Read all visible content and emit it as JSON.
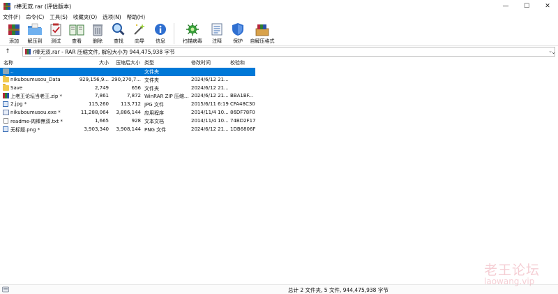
{
  "window": {
    "title": "r棒无双.rar (评估版本)",
    "controls": {
      "minimize": "—",
      "maximize": "☐",
      "close": "✕"
    }
  },
  "menu": {
    "items": [
      "文件(F)",
      "命令(C)",
      "工具(S)",
      "收藏夹(O)",
      "选项(N)",
      "帮助(H)"
    ]
  },
  "toolbar": {
    "buttons": [
      {
        "label": "添加",
        "icon": "add-archive-icon"
      },
      {
        "label": "解压到",
        "icon": "extract-folder-icon"
      },
      {
        "label": "测试",
        "icon": "test-clipboard-icon"
      },
      {
        "label": "查看",
        "icon": "view-book-icon"
      },
      {
        "label": "删除",
        "icon": "trash-icon"
      },
      {
        "label": "查找",
        "icon": "magnifier-icon"
      },
      {
        "label": "向导",
        "icon": "wizard-wand-icon"
      },
      {
        "label": "信息",
        "icon": "info-icon"
      },
      {
        "label": "扫描病毒",
        "icon": "virus-scan-icon"
      },
      {
        "label": "注释",
        "icon": "comment-icon"
      },
      {
        "label": "保护",
        "icon": "shield-icon"
      },
      {
        "label": "自解压格式",
        "icon": "sfx-box-icon"
      }
    ]
  },
  "pathbar": {
    "up_icon": "up-arrow-icon",
    "path_text": "r棒无双.rar - RAR 压缩文件, 解包大小为 944,475,938 字节"
  },
  "columns": {
    "name": "名称",
    "size": "大小",
    "packed": "压缩后大小",
    "type": "类型",
    "modified": "修改时间",
    "crc": "校验和"
  },
  "files": [
    {
      "name": "..",
      "size": "",
      "packed": "",
      "type": "文件夹",
      "modified": "",
      "crc": "",
      "kind": "upfolder",
      "selected": true
    },
    {
      "name": "nikuboumusou_Data",
      "size": "929,156,9...",
      "packed": "290,270,7...",
      "type": "文件夹",
      "modified": "2024/6/12 21...",
      "crc": "",
      "kind": "folder",
      "selected": false
    },
    {
      "name": "Save",
      "size": "2,749",
      "packed": "656",
      "type": "文件夹",
      "modified": "2024/6/12 21...",
      "crc": "",
      "kind": "folder",
      "selected": false
    },
    {
      "name": "上老王论坛当老王.zip *",
      "size": "7,861",
      "packed": "7,872",
      "type": "WinRAR ZIP 压缩...",
      "modified": "2024/6/12 21...",
      "crc": "BBA1BF...",
      "kind": "zip",
      "selected": false
    },
    {
      "name": "2.jpg *",
      "size": "115,260",
      "packed": "113,712",
      "type": "JPG 文件",
      "modified": "2015/6/11 6:19",
      "crc": "CFA48C30",
      "kind": "img",
      "selected": false
    },
    {
      "name": "nikuboumusou.exe *",
      "size": "11,288,064",
      "packed": "3,886,144",
      "type": "应用程序",
      "modified": "2014/11/4 10...",
      "crc": "86DF78F0",
      "kind": "exe",
      "selected": false
    },
    {
      "name": "readme-肉棒無双.txt *",
      "size": "1,665",
      "packed": "928",
      "type": "文本文档",
      "modified": "2014/11/4 10...",
      "crc": "74BD2F17",
      "kind": "doc",
      "selected": false
    },
    {
      "name": "无标题.png *",
      "size": "3,903,340",
      "packed": "3,908,144",
      "type": "PNG 文件",
      "modified": "2024/6/12 21...",
      "crc": "1DB6806F",
      "kind": "img",
      "selected": false
    }
  ],
  "status": {
    "text": "总计 2 文件夹, 5 文件, 944,475,938 字节"
  },
  "watermark": {
    "cn": "老王论坛",
    "en": "laowang.vip"
  },
  "colors": {
    "selection": "#0078d7",
    "watermark": "#dc5064"
  }
}
